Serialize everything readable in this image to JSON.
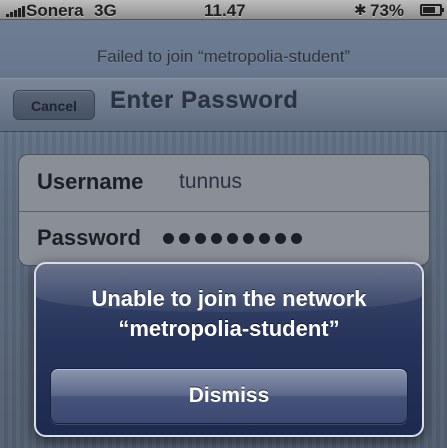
{
  "status_bar": {
    "carrier": "Sonera",
    "network": "3G",
    "time": "11.47",
    "bluetooth_icon": "bluetooth-icon",
    "battery": "73%",
    "battery_level": 0.73
  },
  "wifi_prompt": {
    "message": "Failed to join “metropolia-student”"
  },
  "navbar": {
    "cancel_label": "Cancel",
    "title": "Enter Password"
  },
  "form": {
    "username_label": "Username",
    "username_value": "tunnus",
    "password_label": "Password",
    "password_mask_length": 9
  },
  "alert": {
    "line1": "Unable to join the network",
    "line2": "“metropolia-student”",
    "dismiss_label": "Dismiss"
  }
}
